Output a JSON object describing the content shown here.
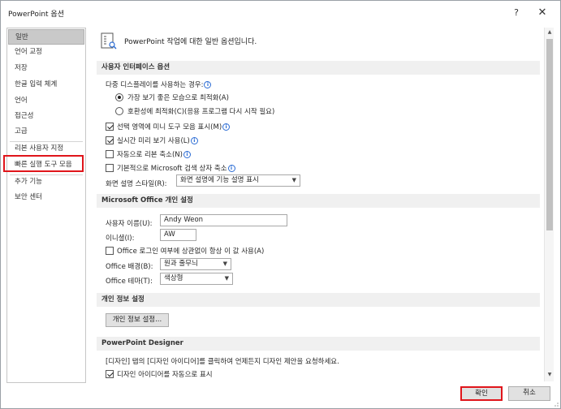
{
  "window": {
    "title": "PowerPoint 옵션",
    "help_label": "?",
    "close_label": "✕"
  },
  "sidebar": {
    "items": [
      {
        "label": "일반",
        "selected": true
      },
      {
        "label": "언어 교정"
      },
      {
        "label": "저장"
      },
      {
        "label": "한글 입력 체계"
      },
      {
        "label": "언어"
      },
      {
        "label": "접근성"
      },
      {
        "label": "고급"
      },
      {
        "label": "리본 사용자 지정"
      },
      {
        "label": "빠른 실행 도구 모음"
      },
      {
        "label": "추가 기능"
      },
      {
        "label": "보안 센터"
      }
    ]
  },
  "main": {
    "intro": "PowerPoint 작업에 대한 일반 옵션입니다.",
    "ui_section": {
      "header": "사용자 인터페이스 옵션",
      "multi_display_label": "다중 디스플레이를 사용하는 경우:",
      "radio_best_look": "가장 보기 좋은 모습으로 최적화(A)",
      "radio_compat": "호환성에 최적화(C)(응용 프로그램 다시 시작 필요)",
      "mini_toolbar": "선택 영역에 미니 도구 모음 표시(M)",
      "live_preview": "실시간 미리 보기 사용(L)",
      "collapse_ribbon": "자동으로 리본 축소(N)",
      "collapse_search": "기본적으로 Microsoft 검색 상자 축소",
      "screentip_label": "화면 설명 스타일(R):",
      "screentip_value": "화면 설명에 기능 설명 표시"
    },
    "personalize_section": {
      "header": "Microsoft Office 개인 설정",
      "username_label": "사용자 이름(U):",
      "username_value": "Andy Weon",
      "initials_label": "이니셜(I):",
      "initials_value": "AW",
      "always_use": "Office 로그인 여부에 상관없이 항상 이 값 사용(A)",
      "background_label": "Office 배경(B):",
      "background_value": "원과 줄무늬",
      "theme_label": "Office 테마(T):",
      "theme_value": "색상형"
    },
    "privacy_section": {
      "header": "개인 정보 설정",
      "button": "개인 정보 설정..."
    },
    "designer_section": {
      "header": "PowerPoint Designer",
      "description": "[디자인] 탭의 [디자인 아이디어]를 클릭하여 언제든지 디자인 제안을 요청하세요.",
      "auto_show": "디자인 아이디어를 자동으로 표시"
    }
  },
  "footer": {
    "ok": "확인",
    "cancel": "취소"
  },
  "icons": {
    "info": "i",
    "scroll_up": "▲",
    "scroll_down": "▼",
    "dropdown": "▼"
  },
  "colors": {
    "highlight_red": "#e0151b",
    "info_blue": "#2b6cd4"
  }
}
